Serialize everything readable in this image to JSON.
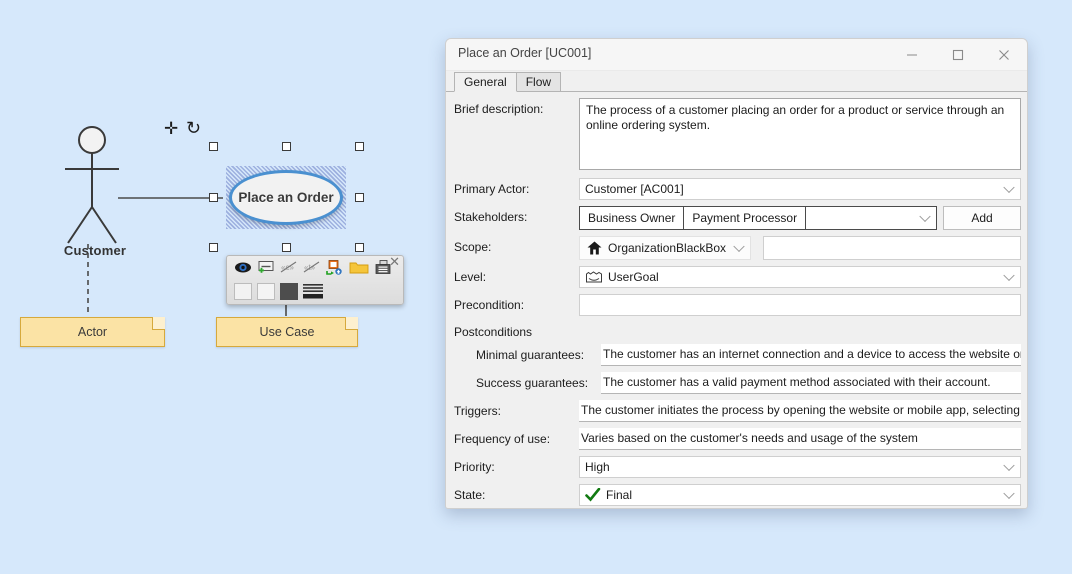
{
  "canvas": {
    "background_color": "#d6e8fb",
    "actor": {
      "name": "actor-stick-figure",
      "label": "Customer"
    },
    "use_case": {
      "label": "Place an Order",
      "selected": true,
      "border_color": "#4a90d0",
      "fill_color": "#f2f2f2"
    },
    "overlay_icons": [
      {
        "name": "move-icon",
        "glyph": "✛"
      },
      {
        "name": "rotate-icon",
        "glyph": "↻"
      }
    ],
    "notes": [
      {
        "name": "note-actor",
        "label": "Actor"
      },
      {
        "name": "note-use-case",
        "label": "Use Case"
      }
    ],
    "mini_toolbar": {
      "close_glyph": "✕",
      "icons": [
        {
          "name": "visibility-eye-icon"
        },
        {
          "name": "add-caption-icon"
        },
        {
          "name": "hide-stereotype-icon"
        },
        {
          "name": "hide-tagged-values-icon"
        },
        {
          "name": "move-to-package-icon"
        },
        {
          "name": "folder-icon"
        },
        {
          "name": "print-layout-icon"
        }
      ],
      "swatches": [
        {
          "name": "fill-swatch-white-1",
          "color": "#f2f2f2"
        },
        {
          "name": "fill-swatch-white-2",
          "color": "#f4f4f4"
        },
        {
          "name": "fill-swatch-dark",
          "color": "#4d4d4d"
        },
        {
          "name": "line-style-swatch",
          "color": "#333333"
        }
      ]
    }
  },
  "dialog": {
    "title": "Place an Order [UC001]",
    "window_buttons": {
      "minimize": "minimize-button",
      "maximize": "maximize-button",
      "close": "close-button"
    },
    "tabs": [
      {
        "label": "General",
        "active": true
      },
      {
        "label": "Flow",
        "active": false
      }
    ],
    "fields": {
      "brief_description_label": "Brief description:",
      "brief_description_value": "The process of a customer placing an order for a product or service through an online ordering system.",
      "primary_actor_label": "Primary Actor:",
      "primary_actor_value": "Customer [AC001]",
      "stakeholders_label": "Stakeholders:",
      "stakeholders_chips": [
        "Business Owner",
        "Payment Processor"
      ],
      "stakeholders_input_value": "",
      "stakeholders_add_button": "Add",
      "scope_label": "Scope:",
      "scope_value": "OrganizationBlackBox",
      "scope_icon": "house-icon",
      "scope_extra_value": "",
      "level_label": "Level:",
      "level_value": "UserGoal",
      "level_icon": "user-goal-icon",
      "precondition_label": "Precondition:",
      "precondition_value": "",
      "postconditions_label": "Postconditions",
      "minimal_guarantees_label": "Minimal guarantees:",
      "minimal_guarantees_value": "The customer has an internet connection and a device to access the website or mobile app.",
      "success_guarantees_label": "Success guarantees:",
      "success_guarantees_value": "The customer has a valid payment method associated with their account.",
      "triggers_label": "Triggers:",
      "triggers_value": "The customer initiates the process by opening the website or mobile app, selecting the product",
      "frequency_label": "Frequency of use:",
      "frequency_value": "Varies based on the customer's needs and usage of the system",
      "priority_label": "Priority:",
      "priority_value": "High",
      "state_label": "State:",
      "state_value": "Final",
      "state_icon": "green-check-icon"
    }
  }
}
